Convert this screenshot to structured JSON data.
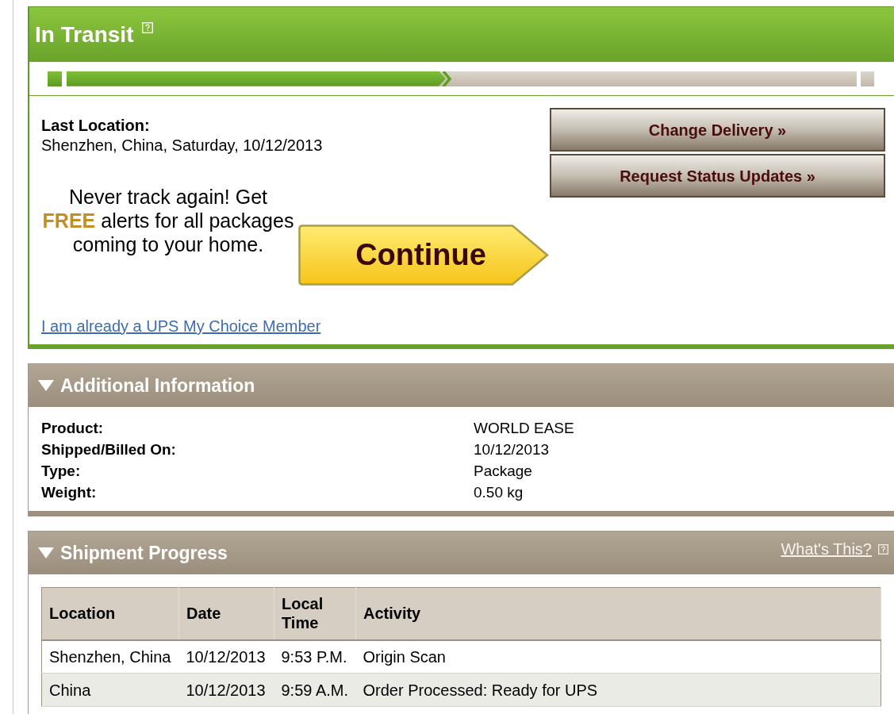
{
  "status": {
    "title": "In Transit"
  },
  "progress": {
    "level": 0.48
  },
  "last_location": {
    "label": "Last Location:",
    "value": "Shenzhen, China, Saturday, 10/12/2013"
  },
  "promo": {
    "text": "Never track again! Get **FREE** alerts for all packages coming to your home.",
    "button": "Continue",
    "link": "I am already a UPS My Choice Member"
  },
  "actions": [
    "Change Delivery »",
    "Request Status Updates »"
  ],
  "additional_information": {
    "title": "Additional Information",
    "expanded": true,
    "rows": [
      {
        "label": "Product:",
        "value": "WORLD EASE"
      },
      {
        "label": "Shipped/Billed On:",
        "value": "10/12/2013"
      },
      {
        "label": "Type:",
        "value": "Package"
      },
      {
        "label": "Weight:",
        "value": "0.50 kg"
      }
    ]
  },
  "shipment_progress": {
    "title": "Shipment Progress",
    "expanded": true,
    "help_link": "What's This?",
    "columns": [
      "Location",
      "Date",
      "Local Time",
      "Activity"
    ],
    "rows": [
      [
        "Shenzhen, China",
        "10/12/2013",
        "9:53 P.M.",
        "Origin Scan"
      ],
      [
        "China",
        "10/12/2013",
        "9:59 A.M.",
        "Order Processed: Ready for UPS"
      ]
    ]
  }
}
